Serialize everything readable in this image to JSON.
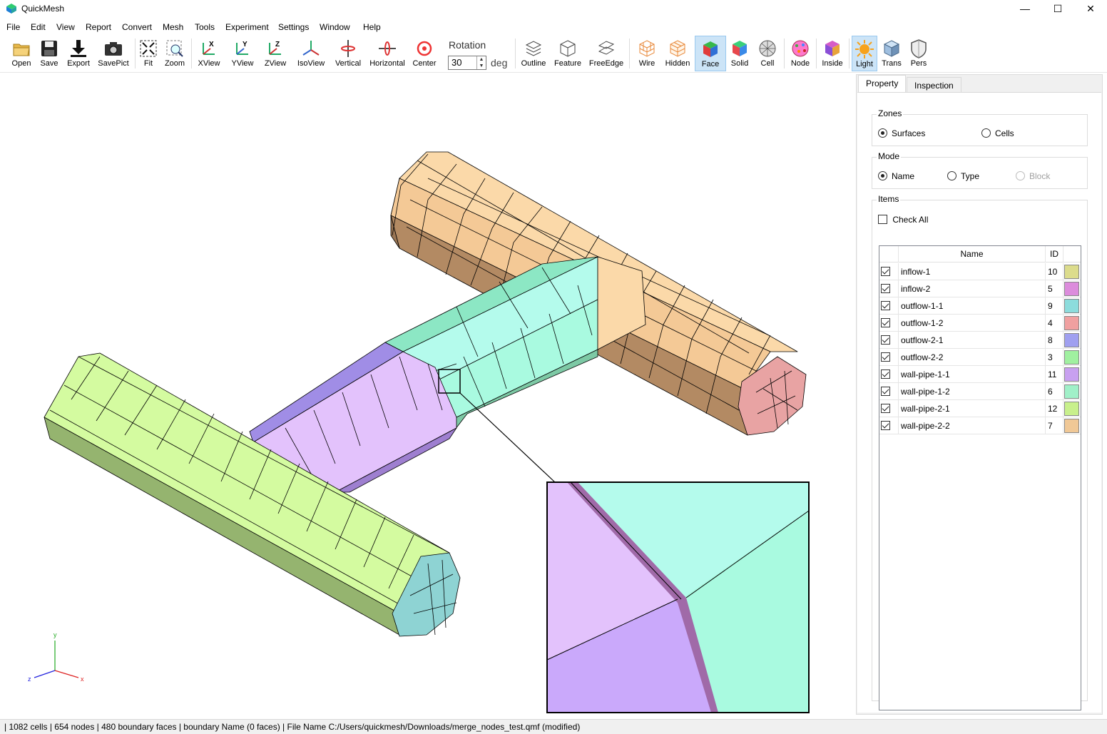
{
  "window": {
    "title": "QuickMesh",
    "minimize_glyph": "—",
    "maximize_glyph": "☐",
    "close_glyph": "✕"
  },
  "menu": [
    "File",
    "Edit",
    "View",
    "Report",
    "Convert",
    "Mesh",
    "Tools",
    "Experiment",
    "Settings",
    "Window",
    "Help"
  ],
  "toolbar": {
    "buttons": [
      {
        "label": "Open",
        "icon": "folder-open-icon"
      },
      {
        "label": "Save",
        "icon": "floppy-disk-icon"
      },
      {
        "label": "Export",
        "icon": "download-arrow-icon"
      },
      {
        "label": "SavePict",
        "icon": "camera-icon"
      },
      {
        "label": "Fit",
        "icon": "fit-arrows-icon"
      },
      {
        "label": "Zoom",
        "icon": "zoom-magnifier-icon"
      },
      {
        "label": "XView",
        "icon": "axis-x-view-icon",
        "glyph": "X"
      },
      {
        "label": "YView",
        "icon": "axis-y-view-icon",
        "glyph": "Y"
      },
      {
        "label": "ZView",
        "icon": "axis-z-view-icon",
        "glyph": "Z"
      },
      {
        "label": "IsoView",
        "icon": "iso-axes-icon"
      },
      {
        "label": "Vertical",
        "icon": "vertical-rotate-icon"
      },
      {
        "label": "Horizontal",
        "icon": "horizontal-rotate-icon"
      },
      {
        "label": "Center",
        "icon": "center-target-icon"
      },
      {
        "label": "Outline",
        "icon": "outline-layers-icon"
      },
      {
        "label": "Feature",
        "icon": "feature-cube-icon"
      },
      {
        "label": "FreeEdge",
        "icon": "free-edge-icon"
      },
      {
        "label": "Wire",
        "icon": "wire-cube-icon"
      },
      {
        "label": "Hidden",
        "icon": "hidden-line-cube-icon"
      },
      {
        "label": "Face",
        "icon": "face-cube-icon",
        "active": true
      },
      {
        "label": "Solid",
        "icon": "solid-cube-icon"
      },
      {
        "label": "Cell",
        "icon": "cell-sphere-icon"
      },
      {
        "label": "Node",
        "icon": "node-sphere-icon"
      },
      {
        "label": "Inside",
        "icon": "inside-cube-icon"
      },
      {
        "label": "Light",
        "icon": "light-sun-icon",
        "active": true
      },
      {
        "label": "Trans",
        "icon": "transparent-cube-icon"
      },
      {
        "label": "Pers",
        "icon": "perspective-shield-icon"
      }
    ],
    "rotation": {
      "label": "Rotation",
      "value": "30",
      "unit": "deg"
    }
  },
  "viewport": {
    "axes": {
      "x": "x",
      "y": "y",
      "z": "z"
    }
  },
  "panel": {
    "tabs": [
      "Property",
      "Inspection"
    ],
    "zones": {
      "title": "Zones",
      "options": [
        "Surfaces",
        "Cells"
      ],
      "selected": "Surfaces"
    },
    "mode": {
      "title": "Mode",
      "options": [
        "Name",
        "Type",
        "Block"
      ],
      "selected": "Name",
      "disabled": [
        "Block"
      ]
    },
    "items": {
      "title": "Items",
      "check_all_label": "Check All",
      "columns": {
        "name": "Name",
        "id": "ID"
      },
      "rows": [
        {
          "name": "inflow-1",
          "id": "10",
          "color": "#dcdc8c",
          "checked": true
        },
        {
          "name": "inflow-2",
          "id": "5",
          "color": "#dc8cdc",
          "checked": true
        },
        {
          "name": "outflow-1-1",
          "id": "9",
          "color": "#8cdcdc",
          "checked": true
        },
        {
          "name": "outflow-1-2",
          "id": "4",
          "color": "#f0a0a0",
          "checked": true
        },
        {
          "name": "outflow-2-1",
          "id": "8",
          "color": "#a0a0f0",
          "checked": true
        },
        {
          "name": "outflow-2-2",
          "id": "3",
          "color": "#a0f0a0",
          "checked": true
        },
        {
          "name": "wall-pipe-1-1",
          "id": "11",
          "color": "#c8a0f0",
          "checked": true
        },
        {
          "name": "wall-pipe-1-2",
          "id": "6",
          "color": "#a0f0c8",
          "checked": true
        },
        {
          "name": "wall-pipe-2-1",
          "id": "12",
          "color": "#c8f08c",
          "checked": true
        },
        {
          "name": "wall-pipe-2-2",
          "id": "7",
          "color": "#f0c896",
          "checked": true
        }
      ]
    }
  },
  "status": "| 1082 cells | 654 nodes | 480 boundary faces |  boundary Name  (0 faces) | File Name C:/Users/quickmesh/Downloads/merge_nodes_test.qmf (modified)"
}
